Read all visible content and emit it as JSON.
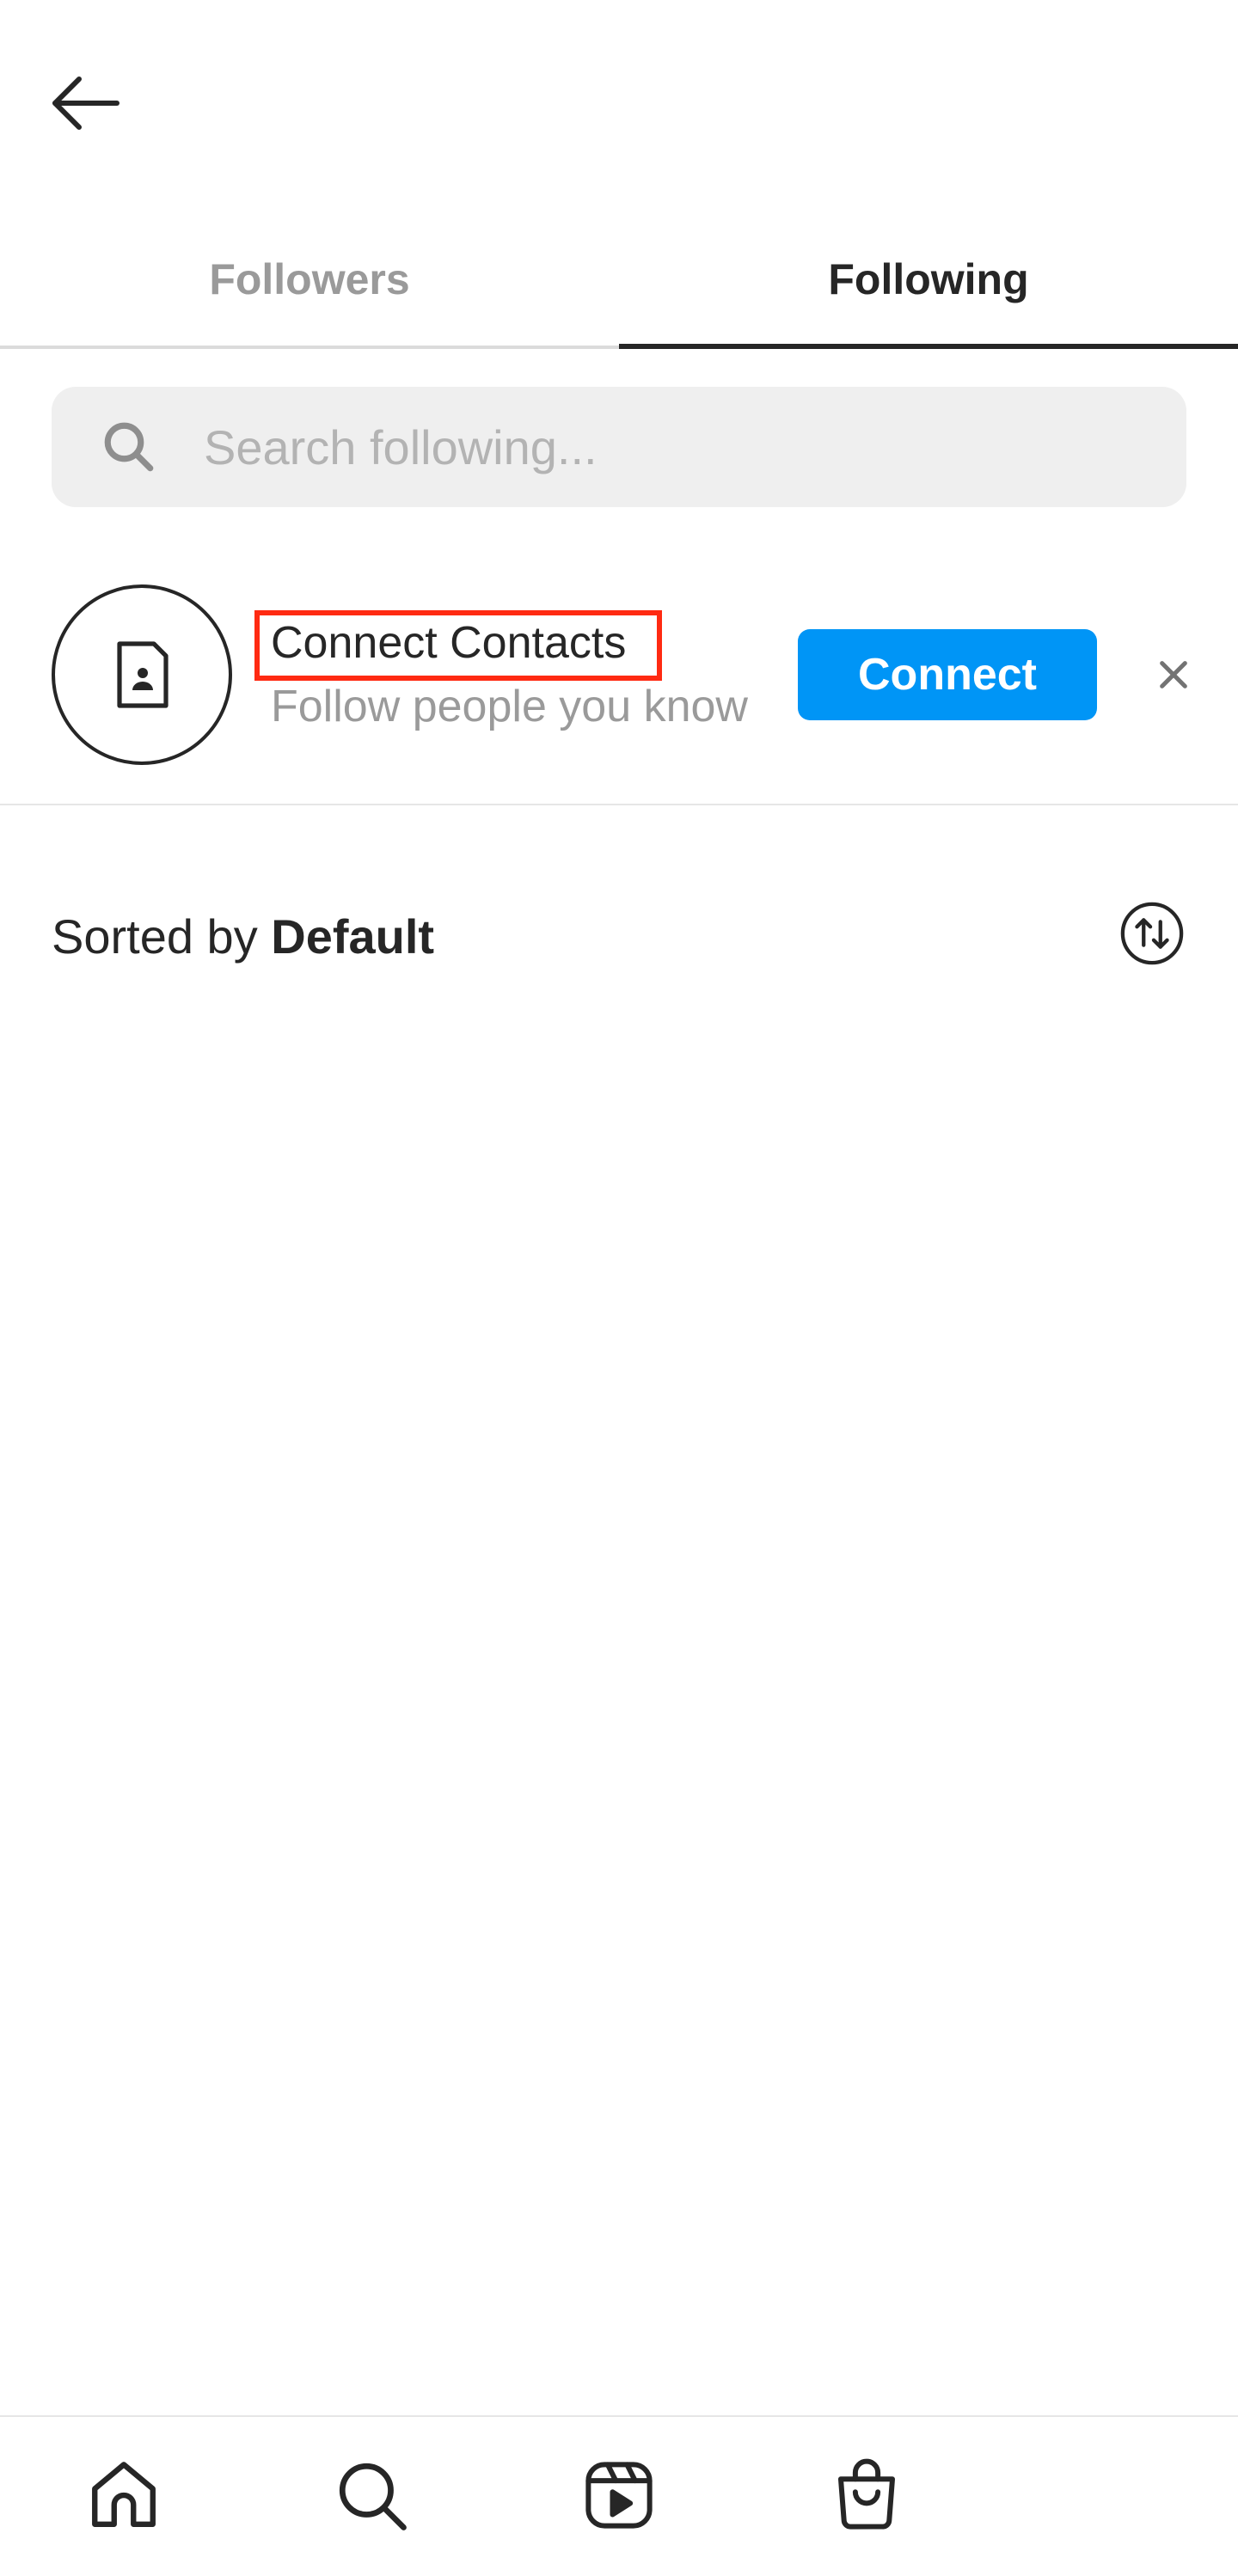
{
  "header": {
    "back_icon": "arrow-left-icon"
  },
  "tabs": [
    {
      "label": "Followers",
      "active": false
    },
    {
      "label": "Following",
      "active": true
    }
  ],
  "search": {
    "placeholder": "Search following...",
    "value": "",
    "icon": "search-icon"
  },
  "suggestion": {
    "icon": "contact-card-icon",
    "title": "Connect Contacts",
    "subtitle": "Follow people you know",
    "button_label": "Connect",
    "dismiss_icon": "close-icon",
    "highlight_color": "#ff2a12"
  },
  "sort": {
    "prefix": "Sorted by ",
    "value": "Default",
    "icon": "sort-arrows-icon"
  },
  "bottom_nav": [
    {
      "icon": "home-icon"
    },
    {
      "icon": "search-icon"
    },
    {
      "icon": "reels-icon"
    },
    {
      "icon": "shop-icon"
    }
  ],
  "colors": {
    "accent": "#0095f6",
    "text": "#262626",
    "muted": "#9a9a9a",
    "search_bg": "#efefef"
  }
}
